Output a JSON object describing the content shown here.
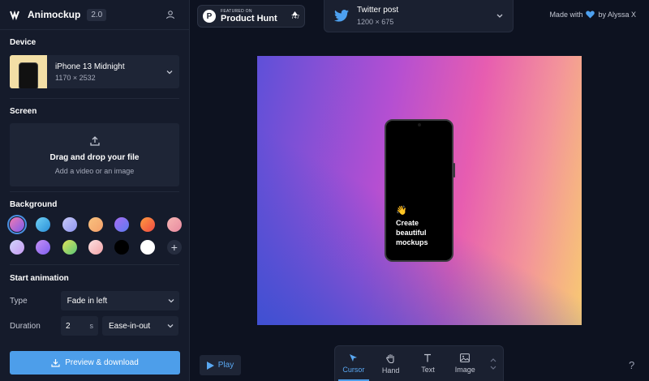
{
  "app": {
    "name": "Animockup",
    "version": "2.0"
  },
  "sidebar": {
    "device": {
      "section_title": "Device",
      "name": "iPhone 13 Midnight",
      "resolution": "1170 × 2532"
    },
    "screen": {
      "section_title": "Screen",
      "drop_title": "Drag and drop your file",
      "drop_subtitle": "Add a video or an image"
    },
    "background": {
      "section_title": "Background",
      "selected_index": 0,
      "swatches": [
        "linear-gradient(135deg,#f27ab0,#7b5cf0)",
        "linear-gradient(135deg,#6fd0f5,#2a8fd8)",
        "linear-gradient(135deg,#c7c9f7,#8f95f0)",
        "linear-gradient(135deg,#f8c27e,#f59f6a)",
        "linear-gradient(135deg,#a86df2,#5b7bf0)",
        "linear-gradient(135deg,#fd9a3f,#f04a44)",
        "linear-gradient(135deg,#f6b5b3,#e98aa0)",
        "linear-gradient(135deg,#cfd4fb,#c89bf2)",
        "linear-gradient(135deg,#c590f5,#7f5ff0)",
        "linear-gradient(135deg,#e3e25a,#58c778)",
        "linear-gradient(135deg,#fce1e1,#f3a3a8)",
        "#000000",
        "#ffffff"
      ],
      "add_label": "+"
    },
    "animation": {
      "section_title": "Start animation",
      "type_label": "Type",
      "type_value": "Fade in left",
      "duration_label": "Duration",
      "duration_value": "2",
      "duration_unit": "s",
      "easing_value": "Ease-in-out"
    },
    "primary_button": "Preview & download"
  },
  "header": {
    "product_hunt": {
      "featured": "FEATURED ON",
      "name": "Product Hunt",
      "count": "747"
    },
    "format": {
      "name": "Twitter post",
      "size": "1200 × 675"
    },
    "made_with": {
      "prefix": "Made with",
      "suffix": "by Alyssa X"
    }
  },
  "canvas": {
    "emoji": "👋",
    "text": "Create beautiful mockups"
  },
  "toolbar": {
    "play": "Play",
    "tools": [
      {
        "label": "Cursor",
        "active": true
      },
      {
        "label": "Hand",
        "active": false
      },
      {
        "label": "Text",
        "active": false
      },
      {
        "label": "Image",
        "active": false
      }
    ],
    "help": "?"
  },
  "colors": {
    "accent": "#4d9eea",
    "sidebar_bg": "#151b2b",
    "page_bg": "#0d1220"
  }
}
